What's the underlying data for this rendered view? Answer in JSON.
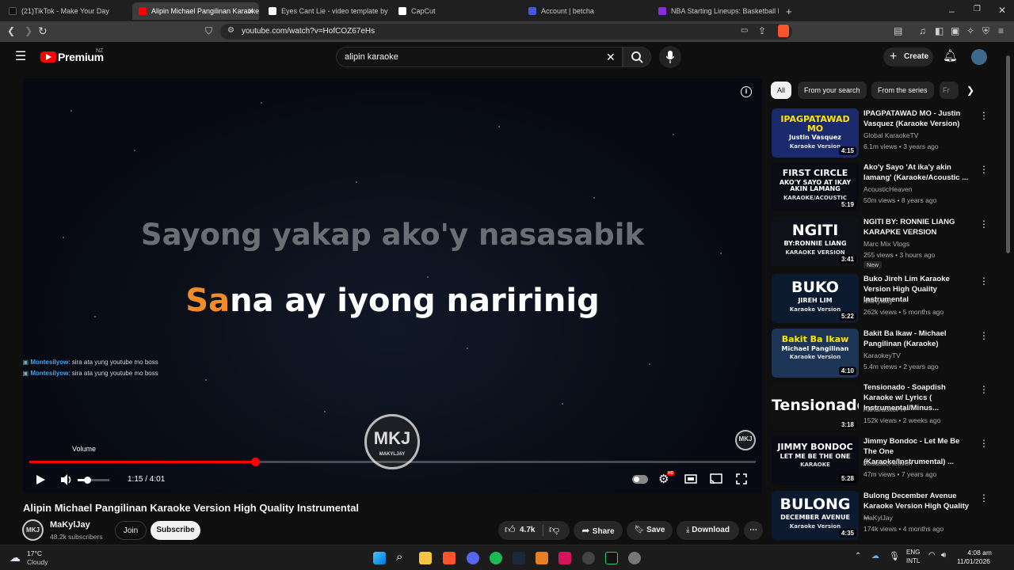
{
  "browser": {
    "tabs": [
      {
        "label": "(21)TikTok - Make Your Day",
        "color": "#222"
      },
      {
        "label": "Alipin Michael Pangilinan Karaoke",
        "color": "#f00"
      },
      {
        "label": "Eyes Cant Lie - video template by Cap",
        "color": "#fff"
      },
      {
        "label": "CapCut",
        "color": "#fff"
      },
      {
        "label": "Account | betcha",
        "color": "#4a55e0"
      },
      {
        "label": "NBA Starting Lineups: Basketball Dai",
        "color": "#8a2be2"
      }
    ],
    "url": "youtube.com/watch?v=HofCOZ67eHs",
    "new_tab": "+"
  },
  "header": {
    "brand": "Premium",
    "region": "NZ",
    "search_value": "alipin karaoke",
    "create_label": "Create"
  },
  "player": {
    "lyric_prev": "Sayong yakap ako'y nasasabik",
    "lyric_current_highlight": "Sa",
    "lyric_current_rest": "na ay iyong naririnig",
    "chat": [
      {
        "user": "Montesilyow",
        "text": ": sira ata yung youtube mo boss"
      },
      {
        "user": "Montesilyow",
        "text": ": sira ata yung youtube mo boss"
      }
    ],
    "watermark": "MKJ",
    "watermark_sub": "MAKYLJAY",
    "volume_tooltip": "Volume",
    "time": "1:15 / 4:01",
    "progress": 0.311,
    "volume_level": 0.3
  },
  "video": {
    "title": "Alipin Michael Pangilinan Karaoke Version High Quality Instrumental",
    "channel": "MaKylJay",
    "subscribers": "48.2k subscribers",
    "join_label": "Join",
    "subscribe_label": "Subscribe",
    "likes": "4.7k",
    "share_label": "Share",
    "save_label": "Save",
    "download_label": "Download"
  },
  "chips": [
    "All",
    "From your search",
    "From the series",
    "Fr"
  ],
  "recommendations": [
    {
      "title": "IPAGPATAWAD MO - Justin Vasquez  (Karaoke Version)",
      "channel": "Global KaraokeTV",
      "meta": "6.1m views • 3 years ago",
      "duration": "4:15",
      "thumb_line1": "IPAGPATAWAD MO",
      "thumb_line2": "Justin Vasquez",
      "thumb_line3": "Karaoke Version",
      "bg": "#1a2a6c",
      "fg": "#ffe600"
    },
    {
      "title": "Ako'y Sayo 'At ika'y akin lamang' (Karaoke/Acoustic ...",
      "channel": "AcousticHeaven",
      "meta": "50m views • 8 years ago",
      "duration": "5:19",
      "thumb_line1": "FIRST CIRCLE",
      "thumb_line2": "AKO'Y SAYO AT IKAY AKIN LAMANG",
      "thumb_line3": "KARAOKE/ACOUSTIC",
      "bg": "#0b0b14",
      "fg": "#ffffff"
    },
    {
      "title": "NGITI BY: RONNIE LIANG KARAPKE VERSION",
      "channel": "Marc Mix Vlogs",
      "meta": "255 views • 3 hours ago",
      "badge": "New",
      "duration": "3:41",
      "thumb_line1": "NGITI",
      "thumb_line2": "BY:RONNIE LIANG",
      "thumb_line3": "KARAOKE VERSION",
      "bg": "#101018",
      "fg": "#ffffff"
    },
    {
      "title": "Buko Jireh Lim Karaoke Version High Quality Instrumental",
      "channel": "MaKylJay",
      "meta": "262k views • 5 months ago",
      "duration": "5:22",
      "thumb_line1": "BUKO",
      "thumb_line2": "JIREH LIM",
      "thumb_line3": "Karaoke Version",
      "bg": "#0c1a30",
      "fg": "#ffffff"
    },
    {
      "title": "Bakit Ba Ikaw - Michael Pangilinan (Karaoke)",
      "channel": "KaraokeyTV",
      "meta": "5.4m views • 2 years ago",
      "duration": "4:10",
      "thumb_line1": "Bakit Ba Ikaw",
      "thumb_line2": "Michael Pangilinan",
      "thumb_line3": "Karaoke Version",
      "bg": "#1d3557",
      "fg": "#ffe600"
    },
    {
      "title": "Tensionado - Soapdish Karaoke w/ Lyrics ( Instrumental/Minus...",
      "channel": "AllKaraokePH",
      "meta": "152k views • 2 weeks ago",
      "duration": "3:18",
      "thumb_line1": "Tensionado",
      "thumb_line2": "",
      "thumb_line3": "",
      "bg": "#101010",
      "fg": "#ffffff"
    },
    {
      "title": "Jimmy Bondoc - Let Me Be The One (Karaoke/Instrumental) ...",
      "channel": "AcousticHeaven",
      "meta": "47m views • 7 years ago",
      "duration": "5:28",
      "thumb_line1": "JIMMY BONDOC",
      "thumb_line2": "LET ME BE THE ONE",
      "thumb_line3": "KARAOKE",
      "bg": "#0a0a14",
      "fg": "#ffffff"
    },
    {
      "title": "Bulong December Avenue Karaoke Version High Quality ...",
      "channel": "MaKylJay",
      "meta": "174k views • 4 months ago",
      "duration": "4:35",
      "thumb_line1": "BULONG",
      "thumb_line2": "DECEMBER AVENUE",
      "thumb_line3": "Karaoke Version",
      "bg": "#0c1a30",
      "fg": "#ffffff"
    }
  ],
  "taskbar": {
    "weather_temp": "17°C",
    "weather_desc": "Cloudy",
    "lang1": "ENG",
    "lang2": "INTL",
    "time": "4:08 am",
    "date": "11/01/2026"
  }
}
